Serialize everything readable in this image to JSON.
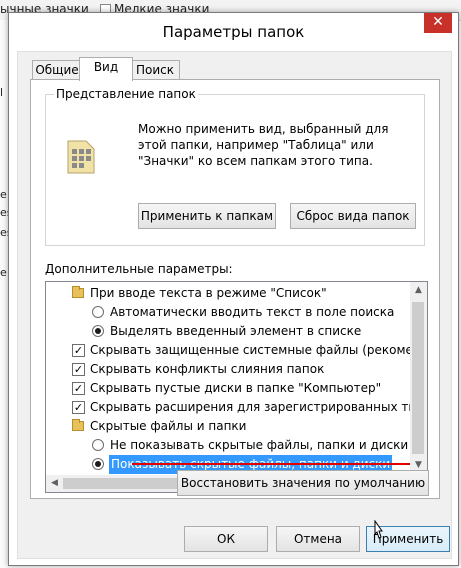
{
  "background": {
    "top_items": [
      "ычные значки",
      "Мелкие значки"
    ],
    "left_chars": [
      "l",
      "e",
      "es",
      "es",
      "e"
    ]
  },
  "dialog": {
    "title": "Параметры папок",
    "close_glyph": "✕",
    "tabs": [
      "Общие",
      "Вид",
      "Поиск"
    ],
    "active_tab": "Вид",
    "folder_view": {
      "legend": "Представление папок",
      "description": "Можно применить вид, выбранный для этой папки, например \"Таблица\" или \"Значки\" ко всем папкам этого типа.",
      "apply_label": "Применить к папкам",
      "reset_label": "Сброс вида папок"
    },
    "advanced": {
      "label": "Дополнительные параметры:",
      "items": [
        {
          "type": "folder",
          "level": 0,
          "text": "При вводе текста в режиме \"Список\""
        },
        {
          "type": "radio",
          "level": 1,
          "checked": false,
          "text": "Автоматически вводить текст в поле поиска"
        },
        {
          "type": "radio",
          "level": 1,
          "checked": true,
          "text": "Выделять введенный элемент в списке"
        },
        {
          "type": "check",
          "level": 0,
          "checked": true,
          "text": "Скрывать защищенные системные файлы (рекомен"
        },
        {
          "type": "check",
          "level": 0,
          "checked": true,
          "text": "Скрывать конфликты слияния папок"
        },
        {
          "type": "check",
          "level": 0,
          "checked": true,
          "text": "Скрывать пустые диски в папке \"Компьютер\""
        },
        {
          "type": "check",
          "level": 0,
          "checked": true,
          "text": "Скрывать расширения для зарегистрированных типо"
        },
        {
          "type": "folder",
          "level": 0,
          "text": "Скрытые файлы и папки"
        },
        {
          "type": "radio",
          "level": 1,
          "checked": false,
          "text": "Не показывать скрытые файлы, папки и диски"
        },
        {
          "type": "radio",
          "level": 1,
          "checked": true,
          "selected": true,
          "text": "Показывать скрытые файлы, папки и диски"
        }
      ]
    },
    "restore_label": "Восстановить значения по умолчанию",
    "ok_label": "ОК",
    "cancel_label": "Отмена",
    "apply_label": "Применить",
    "colors": {
      "selection": "#3399ff",
      "annotation_underline": "#e10000",
      "close_button": "#c7312a"
    }
  }
}
